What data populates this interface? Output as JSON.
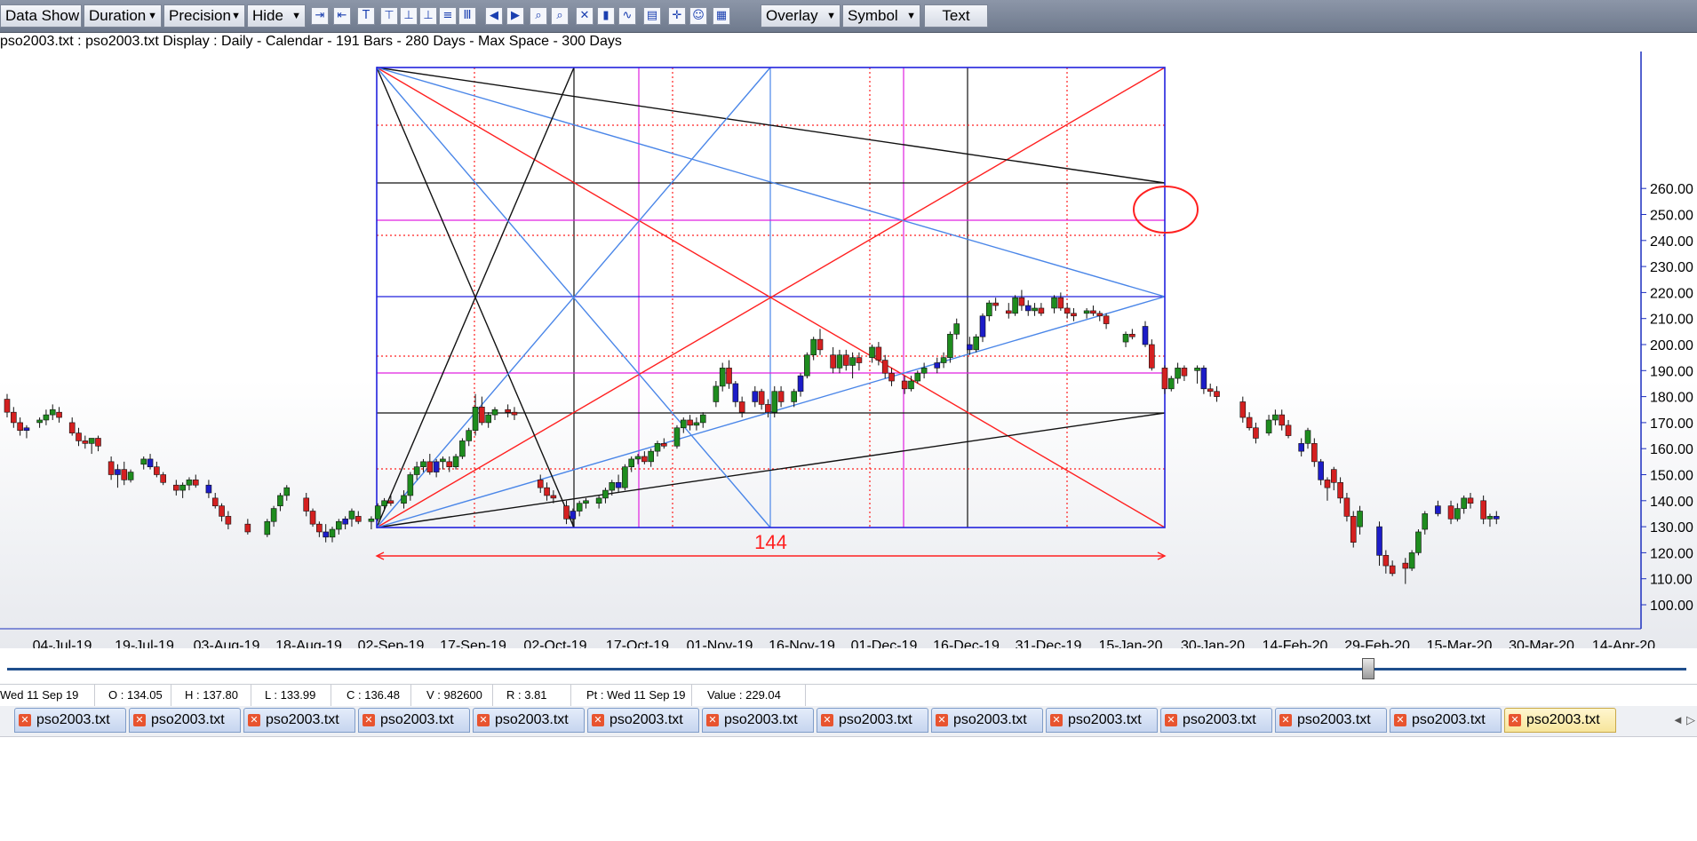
{
  "toolbar": {
    "data_show": "Data Show",
    "duration": "Duration",
    "precision": "Precision",
    "hide": "Hide",
    "overlay": "Overlay",
    "symbol": "Symbol",
    "text": "Text",
    "icons": [
      "zoom-in-horizontal-icon",
      "zoom-out-horizontal-icon",
      "align-top-icon",
      "align-top-bar-icon",
      "align-bottom-icon",
      "align-bottom-bar-icon",
      "list-icon",
      "columns-icon",
      "previous-page-icon",
      "next-page-icon",
      "zoom-in-icon",
      "zoom-out-icon",
      "cross-off-icon",
      "candle-chart-icon",
      "line-chart-icon",
      "data-window-icon",
      "crosshair-icon",
      "user-profile-icon",
      "calendar-icon"
    ]
  },
  "info_line": "pso2003.txt : pso2003.txt Display :  Daily  - Calendar - 191 Bars - 280 Days -  Max Space - 300 Days",
  "chart_data": {
    "type": "candlestick",
    "y_ticks": [
      "260.00",
      "250.00",
      "240.00",
      "230.00",
      "220.00",
      "210.00",
      "200.00",
      "190.00",
      "180.00",
      "170.00",
      "160.00",
      "150.00",
      "140.00",
      "130.00",
      "120.00",
      "110.00",
      "100.00"
    ],
    "x_ticks": [
      "04-Jul-19",
      "19-Jul-19",
      "03-Aug-19",
      "18-Aug-19",
      "02-Sep-19",
      "17-Sep-19",
      "02-Oct-19",
      "17-Oct-19",
      "01-Nov-19",
      "16-Nov-19",
      "01-Dec-19",
      "16-Dec-19",
      "31-Dec-19",
      "15-Jan-20",
      "30-Jan-20",
      "14-Feb-20",
      "29-Feb-20",
      "15-Mar-20",
      "30-Mar-20",
      "14-Apr-20"
    ],
    "ylim": [
      100,
      260
    ],
    "annotation": "144",
    "colors": {
      "up": "#1e8c1e",
      "down": "#d42020",
      "alt": "#1c1cc8",
      "box": "#2222dd",
      "gann_red": "#ff2020",
      "gann_blue": "#4a86e8",
      "gann_black": "#111111",
      "magenta": "#e020e0"
    },
    "candles": [
      [
        0,
        179,
        181,
        172,
        174
      ],
      [
        1,
        174,
        176,
        168,
        170
      ],
      [
        2,
        170,
        172,
        165,
        167
      ],
      [
        3,
        167,
        169,
        164,
        168
      ],
      [
        5,
        170,
        172,
        168,
        171
      ],
      [
        6,
        171,
        175,
        169,
        173
      ],
      [
        7,
        173,
        177,
        171,
        175
      ],
      [
        8,
        174,
        176,
        170,
        172
      ],
      [
        10,
        170,
        172,
        165,
        166
      ],
      [
        11,
        166,
        168,
        161,
        163
      ],
      [
        12,
        163,
        165,
        160,
        162
      ],
      [
        13,
        162,
        164,
        158,
        164
      ],
      [
        14,
        164,
        165,
        159,
        161
      ],
      [
        16,
        155,
        157,
        148,
        150
      ],
      [
        17,
        150,
        154,
        145,
        152
      ],
      [
        18,
        152,
        155,
        146,
        148
      ],
      [
        19,
        148,
        152,
        147,
        151
      ],
      [
        21,
        154,
        157,
        152,
        156
      ],
      [
        22,
        156,
        158,
        152,
        153
      ],
      [
        23,
        153,
        155,
        149,
        150
      ],
      [
        24,
        150,
        151,
        146,
        147
      ],
      [
        26,
        146,
        148,
        142,
        144
      ],
      [
        27,
        144,
        147,
        141,
        146
      ],
      [
        28,
        146,
        149,
        144,
        148
      ],
      [
        29,
        148,
        150,
        145,
        146
      ],
      [
        31,
        146,
        148,
        141,
        143
      ],
      [
        32,
        141,
        143,
        137,
        138
      ],
      [
        33,
        138,
        139,
        132,
        134
      ],
      [
        34,
        134,
        136,
        129,
        131
      ],
      [
        37,
        131,
        133,
        127,
        128
      ],
      [
        40,
        127,
        133,
        126,
        132
      ],
      [
        41,
        132,
        138,
        130,
        137
      ],
      [
        42,
        138,
        143,
        136,
        142
      ],
      [
        43,
        142,
        146,
        140,
        145
      ],
      [
        46,
        141,
        143,
        134,
        136
      ],
      [
        47,
        136,
        137,
        130,
        131
      ],
      [
        48,
        131,
        132,
        126,
        128
      ],
      [
        49,
        128,
        131,
        124,
        126
      ],
      [
        50,
        126,
        130,
        124,
        129
      ],
      [
        51,
        129,
        133,
        127,
        132
      ],
      [
        52,
        131,
        134,
        129,
        133
      ],
      [
        53,
        133,
        137,
        130,
        136
      ],
      [
        54,
        134,
        136,
        131,
        132
      ],
      [
        56,
        132,
        134,
        129,
        133
      ],
      [
        57,
        133,
        139,
        132,
        138
      ],
      [
        58,
        138,
        141,
        136,
        140
      ],
      [
        59,
        140,
        142,
        138,
        139
      ],
      [
        61,
        139,
        144,
        137,
        142
      ],
      [
        62,
        142,
        151,
        140,
        150
      ],
      [
        63,
        150,
        155,
        148,
        153
      ],
      [
        64,
        153,
        156,
        151,
        155
      ],
      [
        65,
        155,
        158,
        150,
        151
      ],
      [
        66,
        151,
        156,
        149,
        155
      ],
      [
        67,
        155,
        157,
        152,
        156
      ],
      [
        68,
        155,
        157,
        151,
        153
      ],
      [
        69,
        153,
        158,
        152,
        157
      ],
      [
        70,
        157,
        164,
        156,
        163
      ],
      [
        71,
        163,
        168,
        161,
        167
      ],
      [
        72,
        167,
        181,
        165,
        176
      ],
      [
        73,
        176,
        180,
        169,
        170
      ],
      [
        74,
        170,
        174,
        168,
        173
      ],
      [
        75,
        173,
        176,
        171,
        175
      ],
      [
        77,
        175,
        177,
        172,
        174
      ],
      [
        78,
        174,
        176,
        171,
        173
      ],
      [
        82,
        148,
        150,
        143,
        145
      ],
      [
        83,
        145,
        147,
        140,
        142
      ],
      [
        84,
        142,
        144,
        139,
        141
      ],
      [
        86,
        138,
        140,
        131,
        133
      ],
      [
        87,
        133,
        137,
        130,
        136
      ],
      [
        88,
        136,
        140,
        134,
        139
      ],
      [
        89,
        139,
        141,
        137,
        140
      ],
      [
        91,
        139,
        142,
        137,
        141
      ],
      [
        92,
        141,
        145,
        139,
        144
      ],
      [
        93,
        144,
        148,
        142,
        147
      ],
      [
        94,
        147,
        150,
        143,
        145
      ],
      [
        95,
        145,
        154,
        144,
        153
      ],
      [
        96,
        153,
        157,
        151,
        156
      ],
      [
        97,
        156,
        158,
        154,
        157
      ],
      [
        98,
        157,
        159,
        154,
        155
      ],
      [
        99,
        155,
        160,
        153,
        159
      ],
      [
        100,
        159,
        163,
        157,
        162
      ],
      [
        101,
        162,
        164,
        160,
        161
      ],
      [
        103,
        161,
        169,
        160,
        168
      ],
      [
        104,
        168,
        172,
        166,
        171
      ],
      [
        105,
        171,
        173,
        167,
        169
      ],
      [
        106,
        169,
        172,
        167,
        170
      ],
      [
        107,
        170,
        174,
        168,
        173
      ],
      [
        109,
        178,
        186,
        176,
        184
      ],
      [
        110,
        184,
        193,
        182,
        191
      ],
      [
        111,
        191,
        194,
        183,
        185
      ],
      [
        112,
        185,
        186,
        176,
        178
      ],
      [
        113,
        178,
        180,
        172,
        174
      ],
      [
        115,
        178,
        184,
        176,
        182
      ],
      [
        116,
        182,
        183,
        175,
        177
      ],
      [
        117,
        177,
        179,
        172,
        174
      ],
      [
        118,
        174,
        184,
        172,
        182
      ],
      [
        119,
        182,
        184,
        176,
        178
      ],
      [
        121,
        178,
        183,
        176,
        182
      ],
      [
        122,
        182,
        189,
        180,
        188
      ],
      [
        123,
        188,
        197,
        187,
        196
      ],
      [
        124,
        196,
        203,
        194,
        202
      ],
      [
        125,
        202,
        206,
        196,
        198
      ],
      [
        127,
        196,
        199,
        189,
        191
      ],
      [
        128,
        191,
        198,
        189,
        196
      ],
      [
        129,
        196,
        198,
        190,
        192
      ],
      [
        130,
        192,
        197,
        187,
        195
      ],
      [
        131,
        195,
        197,
        190,
        193
      ],
      [
        133,
        195,
        200,
        193,
        199
      ],
      [
        134,
        199,
        201,
        192,
        194
      ],
      [
        135,
        194,
        196,
        187,
        189
      ],
      [
        136,
        189,
        191,
        184,
        186
      ],
      [
        138,
        186,
        188,
        181,
        183
      ],
      [
        139,
        183,
        188,
        182,
        186
      ],
      [
        140,
        186,
        190,
        185,
        189
      ],
      [
        141,
        189,
        193,
        187,
        191
      ],
      [
        143,
        191,
        195,
        189,
        193
      ],
      [
        144,
        193,
        197,
        191,
        195
      ],
      [
        145,
        195,
        205,
        193,
        204
      ],
      [
        146,
        204,
        210,
        202,
        208
      ],
      [
        148,
        200,
        203,
        196,
        198
      ],
      [
        149,
        198,
        204,
        197,
        203
      ],
      [
        150,
        203,
        212,
        201,
        211
      ],
      [
        151,
        211,
        217,
        209,
        216
      ],
      [
        152,
        216,
        218,
        213,
        215
      ],
      [
        154,
        213,
        216,
        210,
        212
      ],
      [
        155,
        212,
        219,
        211,
        218
      ],
      [
        156,
        218,
        221,
        213,
        215
      ],
      [
        157,
        215,
        217,
        211,
        213
      ],
      [
        158,
        213,
        216,
        211,
        214
      ],
      [
        159,
        214,
        216,
        211,
        212
      ],
      [
        161,
        214,
        219,
        212,
        218
      ],
      [
        162,
        218,
        220,
        213,
        214
      ],
      [
        163,
        214,
        216,
        210,
        212
      ],
      [
        164,
        212,
        214,
        209,
        211
      ],
      [
        166,
        212,
        214,
        210,
        213
      ],
      [
        167,
        213,
        215,
        211,
        212
      ],
      [
        168,
        212,
        213,
        209,
        211
      ],
      [
        169,
        211,
        212,
        206,
        208
      ],
      [
        172,
        201,
        205,
        199,
        204
      ],
      [
        173,
        204,
        206,
        202,
        203
      ],
      [
        175,
        207,
        209,
        199,
        200
      ],
      [
        176,
        200,
        202,
        190,
        191
      ],
      [
        178,
        191,
        192,
        181,
        183
      ],
      [
        179,
        183,
        188,
        182,
        187
      ],
      [
        180,
        187,
        193,
        185,
        191
      ],
      [
        181,
        191,
        192,
        186,
        188
      ],
      [
        183,
        190,
        192,
        185,
        191
      ],
      [
        184,
        191,
        192,
        181,
        183
      ],
      [
        185,
        183,
        185,
        180,
        182
      ],
      [
        186,
        182,
        184,
        178,
        180
      ],
      [
        190,
        178,
        180,
        170,
        172
      ],
      [
        191,
        172,
        174,
        167,
        168
      ],
      [
        192,
        168,
        170,
        162,
        164
      ],
      [
        194,
        166,
        173,
        165,
        171
      ],
      [
        195,
        171,
        175,
        169,
        173
      ],
      [
        196,
        173,
        175,
        167,
        169
      ],
      [
        197,
        169,
        171,
        164,
        165
      ],
      [
        199,
        159,
        164,
        157,
        162
      ],
      [
        200,
        162,
        168,
        160,
        167
      ],
      [
        201,
        162,
        164,
        153,
        155
      ],
      [
        202,
        155,
        156,
        146,
        148
      ],
      [
        203,
        148,
        149,
        140,
        145
      ],
      [
        204,
        152,
        153,
        144,
        147
      ],
      [
        205,
        147,
        149,
        139,
        141
      ],
      [
        206,
        141,
        143,
        132,
        134
      ],
      [
        207,
        134,
        136,
        122,
        124
      ],
      [
        208,
        130,
        138,
        127,
        136
      ],
      [
        211,
        130,
        132,
        115,
        119
      ],
      [
        212,
        119,
        121,
        112,
        115
      ],
      [
        213,
        115,
        117,
        111,
        112
      ],
      [
        215,
        116,
        118,
        108,
        114
      ],
      [
        216,
        114,
        121,
        113,
        120
      ],
      [
        217,
        120,
        129,
        119,
        128
      ],
      [
        218,
        129,
        136,
        127,
        135
      ],
      [
        220,
        135,
        140,
        134,
        138
      ],
      [
        222,
        138,
        140,
        131,
        133
      ],
      [
        223,
        133,
        139,
        132,
        137
      ],
      [
        224,
        137,
        142,
        135,
        141
      ],
      [
        225,
        141,
        143,
        137,
        139
      ],
      [
        227,
        140,
        142,
        131,
        133
      ],
      [
        228,
        133,
        135,
        130,
        134
      ],
      [
        229,
        134,
        136,
        131,
        133
      ]
    ]
  },
  "status": {
    "date": "Wed 11 Sep 19",
    "open": "O : 134.05",
    "high": "H : 137.80",
    "low": "L : 133.99",
    "close": "C : 136.48",
    "volume": "V : 982600",
    "range": "R : 3.81",
    "pointer": "Pt : Wed 11 Sep 19",
    "value": "Value : 229.04"
  },
  "tabs": [
    "pso2003.txt",
    "pso2003.txt",
    "pso2003.txt",
    "pso2003.txt",
    "pso2003.txt",
    "pso2003.txt",
    "pso2003.txt",
    "pso2003.txt",
    "pso2003.txt",
    "pso2003.txt",
    "pso2003.txt",
    "pso2003.txt",
    "pso2003.txt",
    "pso2003.txt"
  ],
  "tab_nav": [
    "◄",
    "▷"
  ]
}
